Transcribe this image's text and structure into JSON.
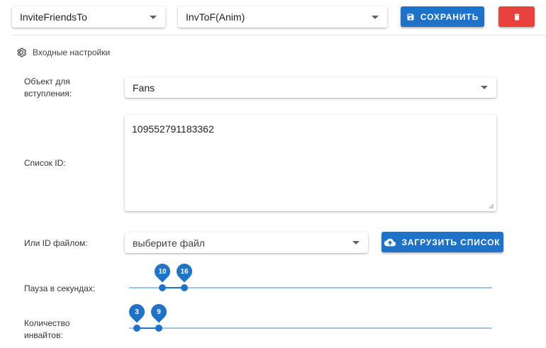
{
  "header": {
    "script_select": "InviteFriendsTo",
    "mode_select": "InvToF(Anim)",
    "save_label": "СОХРАНИТЬ"
  },
  "section": {
    "title": "Входные настройки"
  },
  "form": {
    "target_label": "Объект для вступления:",
    "target_value": "Fans",
    "id_list_label": "Список ID:",
    "id_list_value": "109552791183362",
    "file_label": "Или ID файлом:",
    "file_placeholder": "выберите файл",
    "upload_label": "ЗАГРУЗИТЬ СПИСОК",
    "pause_label": "Пауза в секундах:",
    "pause_min": "10",
    "pause_max": "16",
    "invites_label": "Количество инвайтов:",
    "invites_min": "3",
    "invites_max": "9"
  },
  "colors": {
    "accent": "#1e73c9",
    "danger": "#e9413d"
  },
  "icons": [
    "chevron-down-icon",
    "save-icon",
    "trash-icon",
    "gear-icon",
    "cloud-upload-icon",
    "resize-handle-icon"
  ]
}
